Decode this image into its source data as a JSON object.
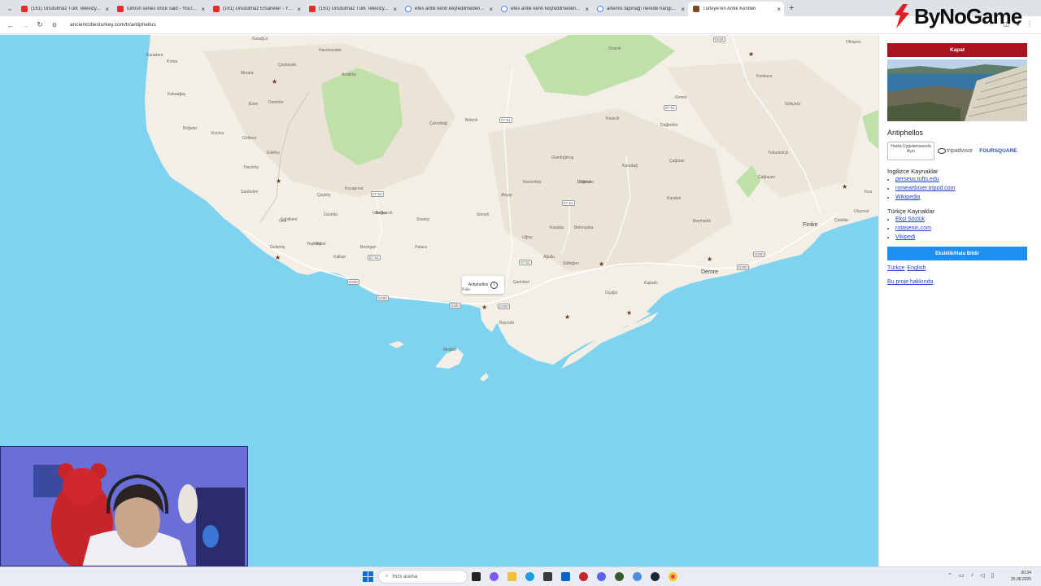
{
  "browser": {
    "tabs": [
      {
        "title": "(161) Unutulmaz Türk Televizy...",
        "favicon": "youtube-icon",
        "active": false
      },
      {
        "title": "turkish series once said - YouT...",
        "favicon": "youtube-icon",
        "active": false
      },
      {
        "title": "(161) Unutulmaz Efsaneler - Yo...",
        "favicon": "youtube-icon",
        "active": false
      },
      {
        "title": "(161) Unutulmaz Türk Televizy...",
        "favicon": "youtube-icon",
        "active": false
      },
      {
        "title": "efes antik kenti keşfedilmeden...",
        "favicon": "google-icon",
        "active": false
      },
      {
        "title": "efes antik kenti keşfedilmeden...",
        "favicon": "google-icon",
        "active": false
      },
      {
        "title": "artemis tapınağı nerede hangi...",
        "favicon": "google-icon",
        "active": false
      },
      {
        "title": "Türkiye'nin Antik Kentleri",
        "favicon": "site-icon",
        "active": true
      }
    ],
    "url": "ancientcitiesturkey.com/tr/antiphellus"
  },
  "overlay_logo": {
    "text": "ByNoGame",
    "color": "#e31e24"
  },
  "map": {
    "popup_label": "Antiphellos",
    "places": [
      {
        "name": "Kasağızı"
      },
      {
        "name": "Karadere"
      },
      {
        "name": "Kırma"
      },
      {
        "name": "Hacımusalar"
      },
      {
        "name": "Çaykavak"
      },
      {
        "name": "Mınara"
      },
      {
        "name": "Arsaköy"
      },
      {
        "name": "Kabaağaç"
      },
      {
        "name": "Kızılca"
      },
      {
        "name": "Boğalar"
      },
      {
        "name": "Gölbent"
      },
      {
        "name": "Esen"
      },
      {
        "name": "Demirler"
      },
      {
        "name": "Eskikıy"
      },
      {
        "name": "Hacıköy"
      },
      {
        "name": "Sarıbelen"
      },
      {
        "name": "Sahilkent"
      },
      {
        "name": "Kalkan"
      },
      {
        "name": "Akbel"
      },
      {
        "name": "Bezirgan"
      },
      {
        "name": "Ova"
      },
      {
        "name": "Yeşilköy"
      },
      {
        "name": "Patara"
      },
      {
        "name": "Gelemiş"
      },
      {
        "name": "Çayköy"
      },
      {
        "name": "Üzümlü"
      },
      {
        "name": "Kocapınar"
      },
      {
        "name": "İslamlar"
      },
      {
        "name": "Belenli"
      },
      {
        "name": "Çukurbağ"
      },
      {
        "name": "Sinneli"
      },
      {
        "name": "Uğrar"
      },
      {
        "name": "Kemerköy"
      },
      {
        "name": "Güllüce"
      },
      {
        "name": "Yuvacık"
      },
      {
        "name": "Akçay"
      },
      {
        "name": "Demre"
      },
      {
        "name": "Olimpos"
      },
      {
        "name": "Kumluca"
      },
      {
        "name": "Finike"
      },
      {
        "name": "Gökçeöz"
      },
      {
        "name": "Yukarıkılıçlı"
      },
      {
        "name": "Beymelek"
      },
      {
        "name": "Çağman"
      },
      {
        "name": "Karadağ"
      },
      {
        "name": "Dağbelen"
      },
      {
        "name": "Dirgenler"
      },
      {
        "name": "Kasaba"
      },
      {
        "name": "Belenyaka"
      },
      {
        "name": "Ağullu"
      },
      {
        "name": "Sütleğen"
      },
      {
        "name": "Karabel"
      },
      {
        "name": "Kapaklı"
      },
      {
        "name": "Üçağız"
      },
      {
        "name": "Kale"
      },
      {
        "name": "Boğazcık"
      },
      {
        "name": "Çamlıbel"
      },
      {
        "name": "Sinekçi"
      },
      {
        "name": "Kemer"
      },
      {
        "name": "Bayındır"
      },
      {
        "name": "Meğisti"
      },
      {
        "name": "Çatallar"
      },
      {
        "name": "Çağlayan"
      },
      {
        "name": "Ovacık"
      },
      {
        "name": "Gündoğmuş"
      },
      {
        "name": "Ilıca"
      },
      {
        "name": "Uluçınar"
      }
    ],
    "roads": [
      "D400",
      "D400",
      "D400",
      "D400",
      "D400",
      "D400",
      "07-52",
      "07-52",
      "07-51",
      "07-51",
      "07-53",
      "07-51",
      "D635"
    ]
  },
  "sidebar": {
    "close_label": "Kapat",
    "site_title": "Antiphellos",
    "maps_button": "Harita Uygulamasında Açın",
    "tripadvisor": "tripadvisor",
    "foursquare": "FOURSQUARE",
    "english_heading": "İngilizce Kaynaklar",
    "english_links": [
      "perseus.tufts.edu",
      "romeartlover.tripod.com",
      "Wikipedia"
    ],
    "turkish_heading": "Türkçe Kaynaklar",
    "turkish_links": [
      "Ekşi Sözlük",
      "rotasenin.com",
      "Vikipedi"
    ],
    "report_label": "Eksiklik/Hata Bildir",
    "lang_tr": "Türkçe",
    "lang_en": "English",
    "about_label": "Bu proje hakkında"
  },
  "taskbar": {
    "search_placeholder": "Hızlı arama",
    "time": "00:34",
    "date": "25.08.2025"
  }
}
